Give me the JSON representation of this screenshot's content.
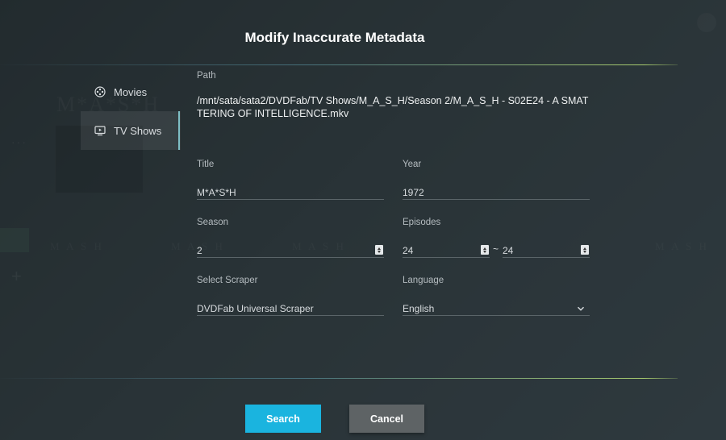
{
  "dialog": {
    "title": "Modify Inaccurate Metadata"
  },
  "sidebar": {
    "items": [
      {
        "label": "Movies",
        "icon": "film-reel-icon",
        "selected": false
      },
      {
        "label": "TV Shows",
        "icon": "tv-icon",
        "selected": true
      }
    ]
  },
  "form": {
    "path_label": "Path",
    "path_value": "/mnt/sata/sata2/DVDFab/TV Shows/M_A_S_H/Season 2/M_A_S_H - S02E24 - A SMATTERING OF INTELLIGENCE.mkv",
    "title_label": "Title",
    "title_value": "M*A*S*H",
    "year_label": "Year",
    "year_value": "1972",
    "season_label": "Season",
    "season_value": "2",
    "episodes_label": "Episodes",
    "episode_from": "24",
    "episode_separator": "~",
    "episode_to": "24",
    "scraper_label": "Select Scraper",
    "scraper_value": "DVDFab Universal Scraper",
    "language_label": "Language",
    "language_value": "English"
  },
  "buttons": {
    "search": "Search",
    "cancel": "Cancel"
  },
  "colors": {
    "search_button": "#1ab4df",
    "cancel_button": "#5e6365",
    "accent_line": "#7fbfc5"
  }
}
